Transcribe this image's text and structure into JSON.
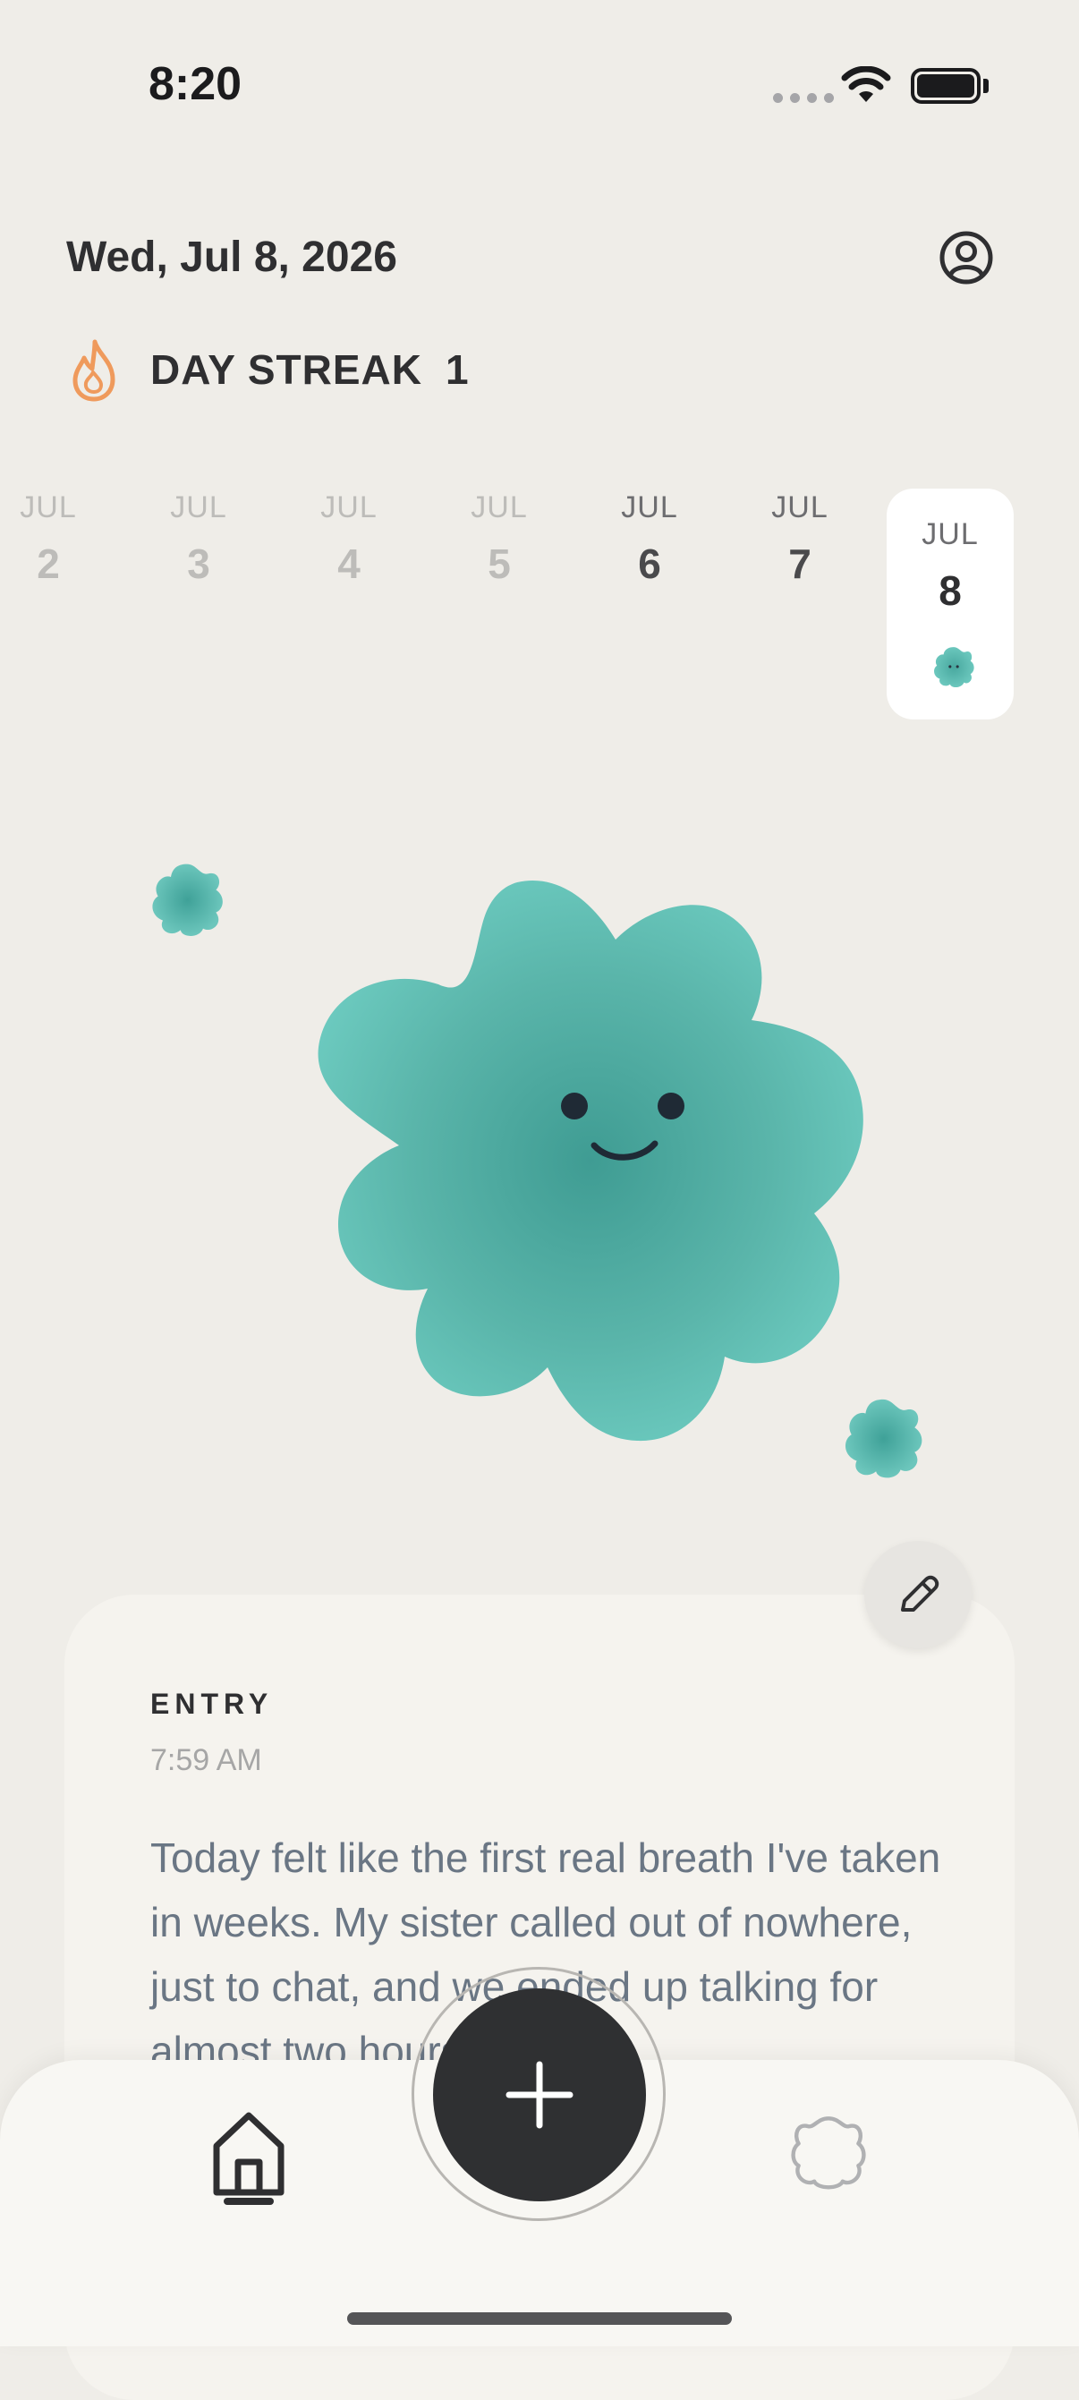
{
  "status_bar": {
    "time": "8:20"
  },
  "header": {
    "date": "Wed, Jul 8, 2026",
    "streak_label": "DAY STREAK",
    "streak_count": "1"
  },
  "date_strip": [
    {
      "month": "JUL",
      "day": "2",
      "state": "faded"
    },
    {
      "month": "JUL",
      "day": "3",
      "state": "faded"
    },
    {
      "month": "JUL",
      "day": "4",
      "state": "faded"
    },
    {
      "month": "JUL",
      "day": "5",
      "state": "faded"
    },
    {
      "month": "JUL",
      "day": "6",
      "state": "normal"
    },
    {
      "month": "JUL",
      "day": "7",
      "state": "normal"
    },
    {
      "month": "JUL",
      "day": "8",
      "state": "selected"
    }
  ],
  "entry": {
    "label": "ENTRY",
    "time": "7:59 AM",
    "text": "Today felt like the first real breath I've taken in weeks. My sister called out of nowhere, just to chat, and we ended up talking for almost two hours. I keep"
  },
  "colors": {
    "accent_teal": "#5fbdb2",
    "background": "#efede8",
    "flame": "#ef9a5c",
    "dark_button": "#2f3032"
  },
  "icons": [
    "profile-icon",
    "flame-icon",
    "pencil-icon",
    "home-icon",
    "plus-icon",
    "flower-icon"
  ]
}
